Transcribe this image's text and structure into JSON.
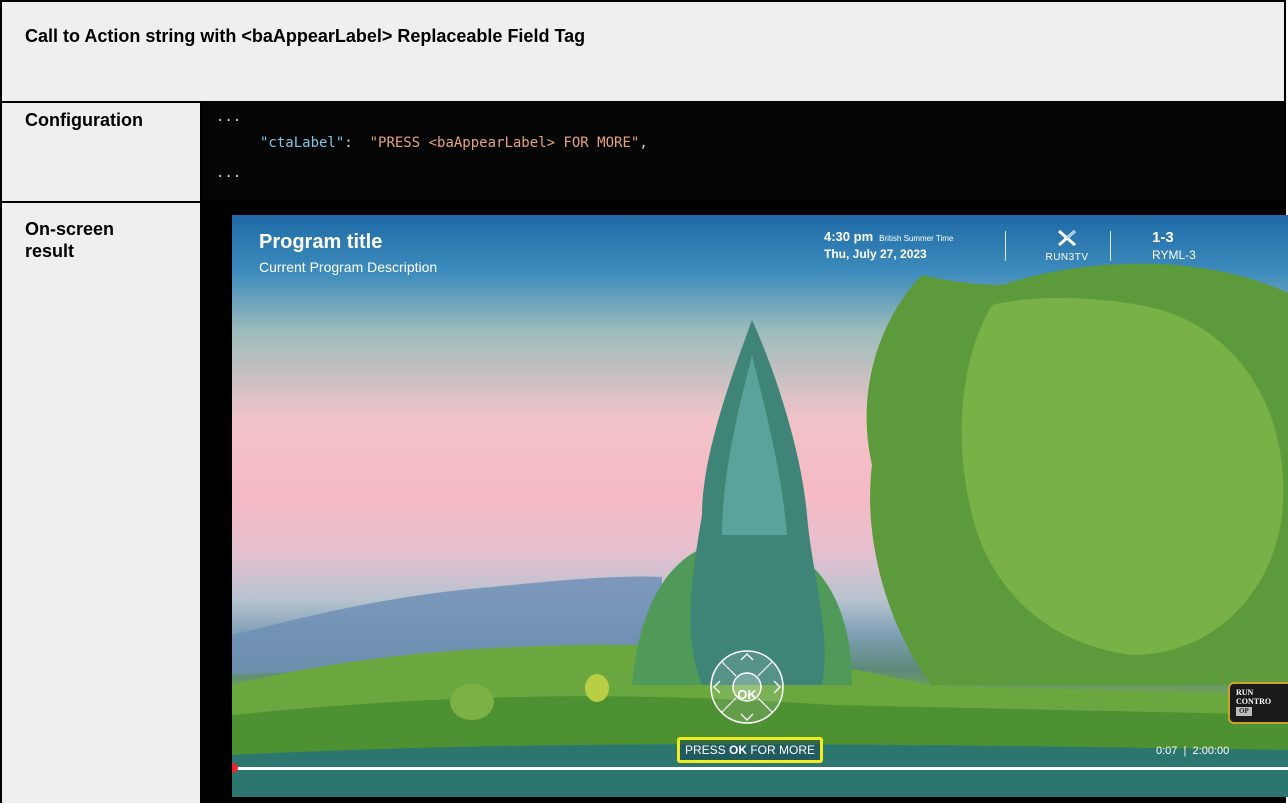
{
  "header": {
    "title": "Call to Action string with <baAppearLabel> Replaceable Field Tag"
  },
  "config": {
    "label": "Configuration",
    "line1": "...",
    "key": "\"ctaLabel\"",
    "colon": ":  ",
    "value": "\"PRESS <baAppearLabel> FOR MORE\"",
    "comma": ",",
    "line3": "..."
  },
  "result": {
    "label_line1": "On-screen",
    "label_line2": "result",
    "player": {
      "program_title": "Program title",
      "program_description": "Current Program Description",
      "time": "4:30 pm",
      "timezone": "British Summer Time",
      "date": "Thu, July 27, 2023",
      "logo_text": "RUN3TV",
      "channel_number": "1-3",
      "channel_name": "RYML-3",
      "ok_label": "OK",
      "cta_prefix": "PRESS ",
      "cta_key": "OK",
      "cta_suffix": " FOR MORE",
      "elapsed_time": "0:07",
      "time_separator": "|",
      "total_time": "2:00:00",
      "progress_fraction": 0.0006,
      "badge_line1": "RUN",
      "badge_line2": "CONTRO",
      "badge_tag": "OP",
      "accent_color": "#f1ec1c",
      "progress_dot_color": "#e8262c"
    }
  }
}
